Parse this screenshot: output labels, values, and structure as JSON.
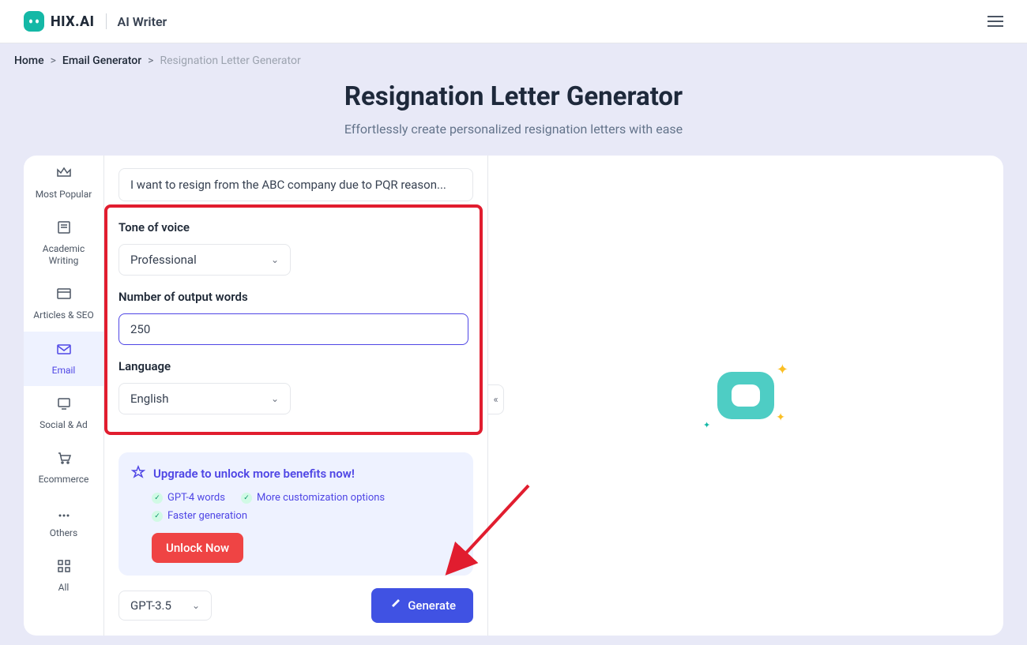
{
  "header": {
    "brand": "HIX.AI",
    "section": "AI Writer"
  },
  "breadcrumb": {
    "home": "Home",
    "email": "Email Generator",
    "current": "Resignation Letter Generator"
  },
  "hero": {
    "title": "Resignation Letter Generator",
    "subtitle": "Effortlessly create personalized resignation letters with ease"
  },
  "sidebar": [
    {
      "label": "Most Popular"
    },
    {
      "label": "Academic Writing"
    },
    {
      "label": "Articles & SEO"
    },
    {
      "label": "Email"
    },
    {
      "label": "Social & Ad"
    },
    {
      "label": "Ecommerce"
    },
    {
      "label": "Others"
    },
    {
      "label": "All"
    }
  ],
  "form": {
    "prompt": "I want to resign from the ABC company due to PQR reason...",
    "tone_label": "Tone of voice",
    "tone_value": "Professional",
    "words_label": "Number of output words",
    "words_value": "250",
    "lang_label": "Language",
    "lang_value": "English"
  },
  "upgrade": {
    "title": "Upgrade to unlock more benefits now!",
    "benefits": [
      "GPT-4 words",
      "More customization options",
      "Faster generation"
    ],
    "button": "Unlock Now"
  },
  "bottom": {
    "model": "GPT-3.5",
    "generate": "Generate"
  }
}
